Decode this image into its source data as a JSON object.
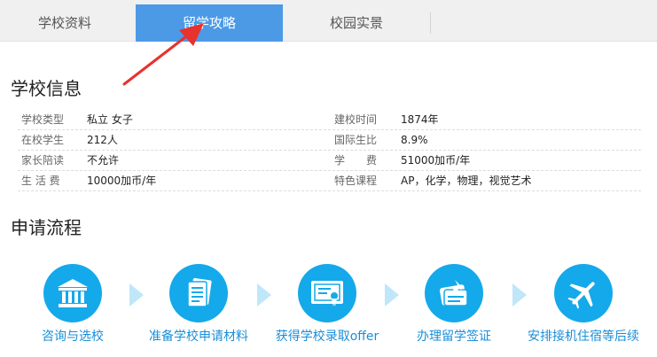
{
  "tabs": [
    {
      "label": "学校资料"
    },
    {
      "label": "留学攻略"
    },
    {
      "label": "校园实景"
    }
  ],
  "school_info": {
    "title": "学校信息",
    "rows": [
      {
        "label1": "学校类型",
        "value1": "私立 女子",
        "label2": "建校时间",
        "value2": "1874年"
      },
      {
        "label1": "在校学生",
        "value1": "212人",
        "label2": "国际生比",
        "value2": "8.9%"
      },
      {
        "label1": "家长陪读",
        "value1": "不允许",
        "label2": "学　　费",
        "value2": "51000加币/年"
      },
      {
        "label1": "生 活 费",
        "value1": "10000加币/年",
        "label2": "特色课程",
        "value2": "AP，化学，物理，视觉艺术"
      }
    ]
  },
  "process": {
    "title": "申请流程",
    "steps": [
      {
        "label": "咨询与选校",
        "icon": "bank-icon"
      },
      {
        "label": "准备学校申请材料",
        "icon": "document-icon"
      },
      {
        "label": "获得学校录取offer",
        "icon": "certificate-icon"
      },
      {
        "label": "办理留学签证",
        "icon": "passport-icon"
      },
      {
        "label": "安排接机住宿等后续",
        "icon": "airplane-icon"
      }
    ]
  },
  "colors": {
    "accent": "#4c9ae6",
    "step_circle": "#14a9ea",
    "step_label": "#1a8ed8",
    "arrow": "#e8322d",
    "chevron": "#bfe7f9"
  }
}
